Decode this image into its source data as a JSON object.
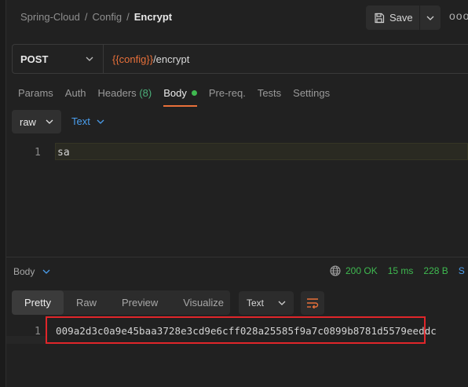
{
  "breadcrumb": {
    "items": [
      "Spring-Cloud",
      "Config"
    ],
    "separator": "/",
    "current": "Encrypt"
  },
  "toolbar": {
    "save_label": "Save",
    "more_label": "ooo"
  },
  "request": {
    "method": "POST",
    "url_variable": "{{config}}",
    "url_path": "/encrypt"
  },
  "tabs": {
    "params": "Params",
    "auth": "Auth",
    "headers": "Headers",
    "headers_count": "(8)",
    "body": "Body",
    "prereq": "Pre-req.",
    "tests": "Tests",
    "settings": "Settings"
  },
  "body_options": {
    "mode": "raw",
    "language": "Text"
  },
  "editor": {
    "line_number": "1",
    "content": "sa"
  },
  "response": {
    "label": "Body",
    "status": "200 OK",
    "time": "15 ms",
    "size": "228 B",
    "truncated": "S",
    "view_tabs": [
      "Pretty",
      "Raw",
      "Preview",
      "Visualize"
    ],
    "format": "Text",
    "line_number": "1",
    "content": "009a2d3c0a9e45baa3728e3cd9e6cff028a25585f9a7c0899b8781d5579eeddc"
  },
  "colors": {
    "accent": "#e8703a",
    "success": "#3fb950",
    "link": "#4a9eed",
    "annotation": "#e0262a"
  }
}
